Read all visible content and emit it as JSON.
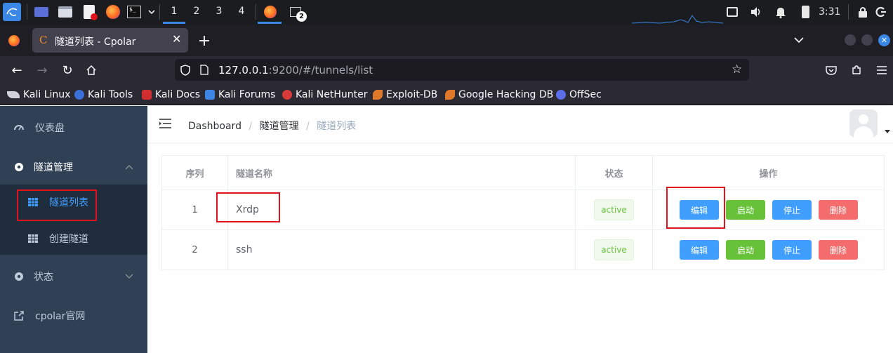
{
  "taskbar": {
    "workspaces": [
      "1",
      "2",
      "3",
      "4"
    ],
    "terminal_badge": "2",
    "clock": "3:31"
  },
  "browser": {
    "tab_title": "隧道列表 - Cpolar",
    "tab_favicon": "C",
    "url_host": "127.0.0.1",
    "url_rest": ":9200/#/tunnels/list",
    "bookmarks": [
      {
        "label": "Kali Linux",
        "color": "#cfd2d8"
      },
      {
        "label": "Kali Tools",
        "color": "#c23a3a"
      },
      {
        "label": "Kali Docs",
        "color": "#d12f2f"
      },
      {
        "label": "Kali Forums",
        "color": "#3d86e6"
      },
      {
        "label": "Kali NetHunter",
        "color": "#d83a3a"
      },
      {
        "label": "Exploit-DB",
        "color": "#e0782a"
      },
      {
        "label": "Google Hacking DB",
        "color": "#e0782a"
      },
      {
        "label": "OffSec",
        "color": "#5b6de8"
      }
    ]
  },
  "sidebar": {
    "dashboard": "仪表盘",
    "tunnel_mgmt": "隧道管理",
    "tunnel_list": "隧道列表",
    "create_tunnel": "创建隧道",
    "status": "状态",
    "cpolar_site": "cpolar官网"
  },
  "breadcrumb": [
    "Dashboard",
    "隧道管理",
    "隧道列表"
  ],
  "table": {
    "headers": [
      "序列",
      "隧道名称",
      "状态",
      "操作"
    ],
    "rows": [
      {
        "index": "1",
        "name": "Xrdp",
        "status": "active"
      },
      {
        "index": "2",
        "name": "ssh",
        "status": "active"
      }
    ],
    "actions": {
      "edit": "编辑",
      "start": "启动",
      "stop": "停止",
      "delete": "删除"
    }
  },
  "colors": {
    "sidebar_bg": "#304156",
    "active_menu": "#409eff",
    "primary": "#409eff",
    "success": "#67c23a",
    "danger": "#f56c6c",
    "highlight_box": "#e0131c"
  }
}
